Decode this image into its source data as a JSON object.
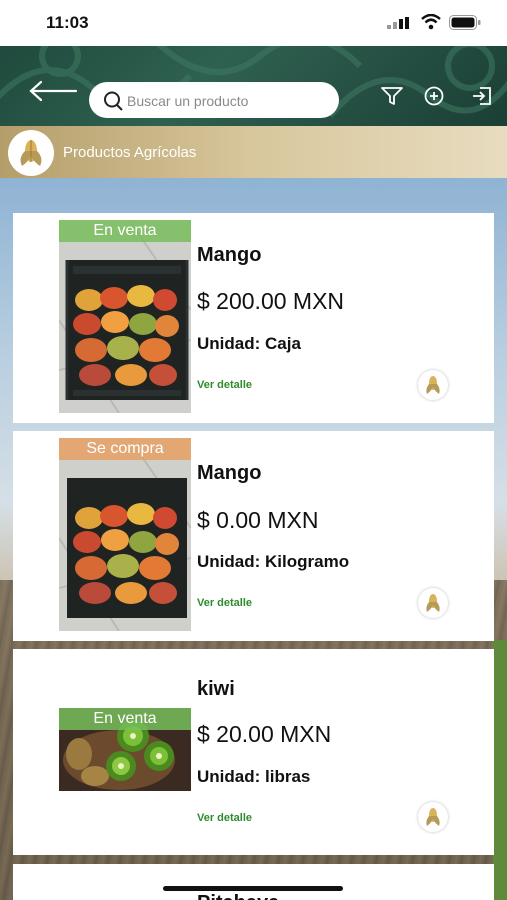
{
  "status": {
    "time": "11:03"
  },
  "header": {
    "search_placeholder": "Buscar un producto",
    "back_icon": "arrow-left-icon",
    "filter_icon": "filter-icon",
    "add_icon": "plus-circle-icon",
    "logout_icon": "logout-icon"
  },
  "category": {
    "label": "Productos Agrícolas",
    "icon": "corn-icon"
  },
  "products": [
    {
      "tag": "En venta",
      "name": "Mango",
      "price": "$ 200.00 MXN",
      "unit_label": "Unidad:",
      "unit": "Caja",
      "detail": "Ver detalle"
    },
    {
      "tag": "Se compra",
      "name": "Mango",
      "price": "$ 0.00 MXN",
      "unit_label": "Unidad:",
      "unit": "Kilogramo",
      "detail": "Ver detalle"
    },
    {
      "tag": "En venta",
      "name": "kiwi",
      "price": "$ 20.00 MXN",
      "unit_label": "Unidad:",
      "unit": "libras",
      "detail": "Ver detalle"
    },
    {
      "name": "Pitahaya"
    }
  ],
  "colors": {
    "header": "#2f6150",
    "detail_link": "#2e8b2e",
    "tag_venta": "#78be5a",
    "tag_compra": "#e6a064"
  }
}
